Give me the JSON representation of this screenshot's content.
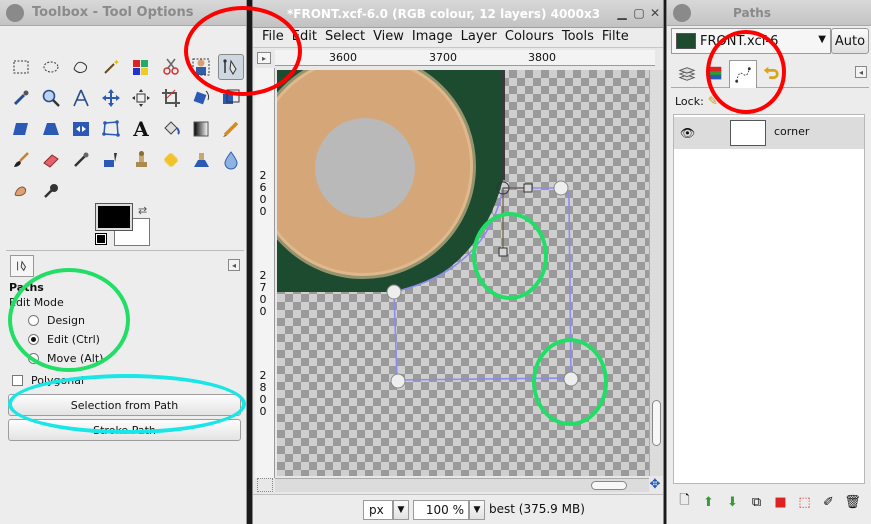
{
  "toolbox": {
    "title": "Toolbox - Tool Options",
    "tool_options": {
      "title": "Paths",
      "subtitle": "Edit Mode",
      "modes": [
        "Design",
        "Edit (Ctrl)",
        "Move (Alt)"
      ],
      "selected_mode": "Edit (Ctrl)",
      "polygonal_label": "Polygonal",
      "polygonal_checked": false,
      "selection_from_path": "Selection from Path",
      "stroke_path": "Stroke Path"
    },
    "tools": [
      "rect-select-icon",
      "ellipse-select-icon",
      "free-select-icon",
      "fuzzy-select-icon",
      "color-select-icon",
      "scissors-select-icon",
      "foreground-select-icon",
      "paths-tool-icon",
      "color-picker-icon",
      "zoom-icon",
      "measure-icon",
      "move-icon",
      "align-icon",
      "crop-icon",
      "rotate-icon",
      "scale-icon",
      "shear-icon",
      "perspective-icon",
      "flip-icon",
      "cage-icon",
      "text-icon",
      "bucket-fill-icon",
      "blend-icon",
      "pencil-icon",
      "paintbrush-icon",
      "eraser-icon",
      "airbrush-icon",
      "ink-icon",
      "clone-icon",
      "heal-icon",
      "perspective-clone-icon",
      "blur-icon",
      "smudge-icon",
      "dodge-burn-icon"
    ],
    "fg_color": "#000000",
    "bg_color": "#ffffff"
  },
  "image_window": {
    "title": "*FRONT.xcf-6.0 (RGB colour, 12 layers) 4000x3",
    "menu": [
      "File",
      "Edit",
      "Select",
      "View",
      "Image",
      "Layer",
      "Colours",
      "Tools",
      "Filte"
    ],
    "hruler_labels": [
      "3600",
      "3700",
      "3800"
    ],
    "vruler_labels": [
      [
        "2",
        "6",
        "0",
        "0"
      ],
      [
        "2",
        "7",
        "0",
        "0"
      ],
      [
        "2",
        "8",
        "0",
        "0"
      ]
    ],
    "units": "px",
    "zoom": "100 %",
    "status": "best (375.9 MB)"
  },
  "dock": {
    "title": "Paths",
    "image_select": "FRONT.xcf-6",
    "auto_label": "Auto",
    "lock_label": "Lock:",
    "paths": [
      {
        "name": "corner",
        "visible": true
      }
    ]
  },
  "colors": {
    "annotation_red": "#ff0000",
    "annotation_green": "#22dd66",
    "annotation_cyan": "#19e6e6",
    "path_stroke": "#8888ee",
    "image_dark_green": "#1c4b30",
    "ring_color": "#d7a979"
  }
}
